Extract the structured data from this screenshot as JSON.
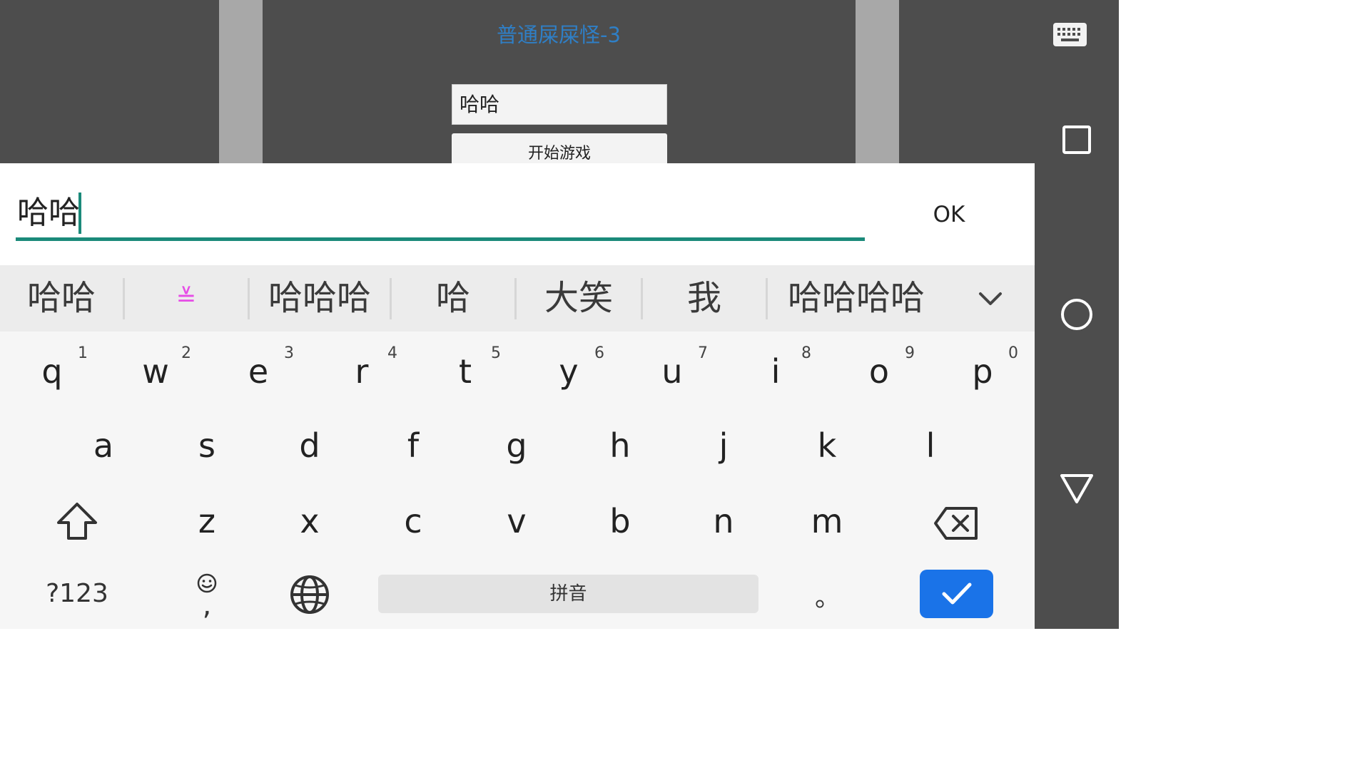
{
  "game": {
    "title": "普通屎屎怪-3",
    "name_value": "哈哈",
    "start_label": "开始游戏"
  },
  "extract": {
    "text": "哈哈",
    "ok_label": "OK"
  },
  "candidates": [
    "哈哈",
    "≚",
    "哈哈哈",
    "哈",
    "大笑",
    "我",
    "哈哈哈哈"
  ],
  "keyboard": {
    "row1": [
      {
        "key": "q",
        "hint": "1"
      },
      {
        "key": "w",
        "hint": "2"
      },
      {
        "key": "e",
        "hint": "3"
      },
      {
        "key": "r",
        "hint": "4"
      },
      {
        "key": "t",
        "hint": "5"
      },
      {
        "key": "y",
        "hint": "6"
      },
      {
        "key": "u",
        "hint": "7"
      },
      {
        "key": "i",
        "hint": "8"
      },
      {
        "key": "o",
        "hint": "9"
      },
      {
        "key": "p",
        "hint": "0"
      }
    ],
    "row2": [
      "a",
      "s",
      "d",
      "f",
      "g",
      "h",
      "j",
      "k",
      "l"
    ],
    "row3": [
      "z",
      "x",
      "c",
      "v",
      "b",
      "n",
      "m"
    ],
    "symbols_label": "?123",
    "comma_label": ",",
    "space_label": "拼音",
    "period_label": "。"
  },
  "colors": {
    "accent_teal": "#1b8a7a",
    "enter_blue": "#1a73e8",
    "title_blue": "#2f7fc6",
    "kaomoji_pink": "#e64ce6"
  },
  "icons": {
    "nav": [
      "keyboard-icon",
      "recents-icon",
      "home-icon",
      "back-icon"
    ],
    "keyboard": [
      "shift-icon",
      "backspace-icon",
      "emoji-icon",
      "globe-icon",
      "check-icon",
      "chevron-down-icon"
    ]
  }
}
